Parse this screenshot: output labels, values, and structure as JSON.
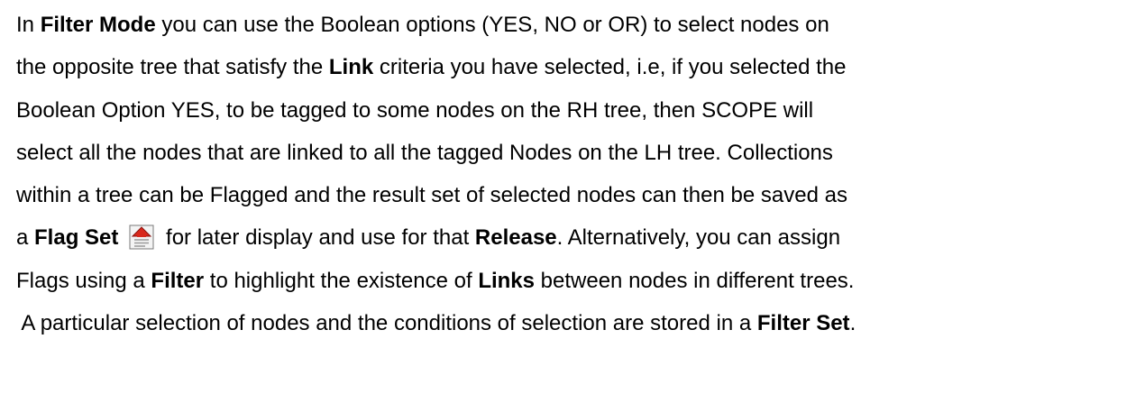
{
  "paragraph": {
    "l1_a": "In ",
    "l1_b": "Filter Mode",
    "l1_c": " you can use the Boolean options (YES, NO or OR) to select nodes on",
    "l2_a": "the opposite tree that satisfy the ",
    "l2_b": "Link",
    "l2_c": " criteria you have selected, i.e, if you selected the",
    "l3": "Boolean Option YES, to be tagged to some nodes on the RH tree, then SCOPE will",
    "l4": "select all the nodes that are linked to all the tagged Nodes on the LH tree.  Collections",
    "l5": "within a tree can be Flagged and the result set of selected nodes can then be saved as",
    "l6_a": "a ",
    "l6_b": "Flag Set",
    "l6_c": " for later display and use for that ",
    "l6_d": "Release",
    "l6_e": ".  Alternatively, you can assign",
    "l7_a": "Flags using a ",
    "l7_b": "Filter",
    "l7_c": " to highlight the existence of ",
    "l7_d": "Links",
    "l7_e": " between nodes in different trees.",
    "l8_a": " A particular selection of nodes and the conditions of selection are stored in a ",
    "l8_b": "Filter Set",
    "l8_c": "."
  },
  "icons": {
    "flag_set": "flag-set-icon"
  },
  "colors": {
    "icon_red": "#d8281c",
    "icon_doc": "#f4f4f4",
    "icon_border": "#7a7a7a"
  }
}
